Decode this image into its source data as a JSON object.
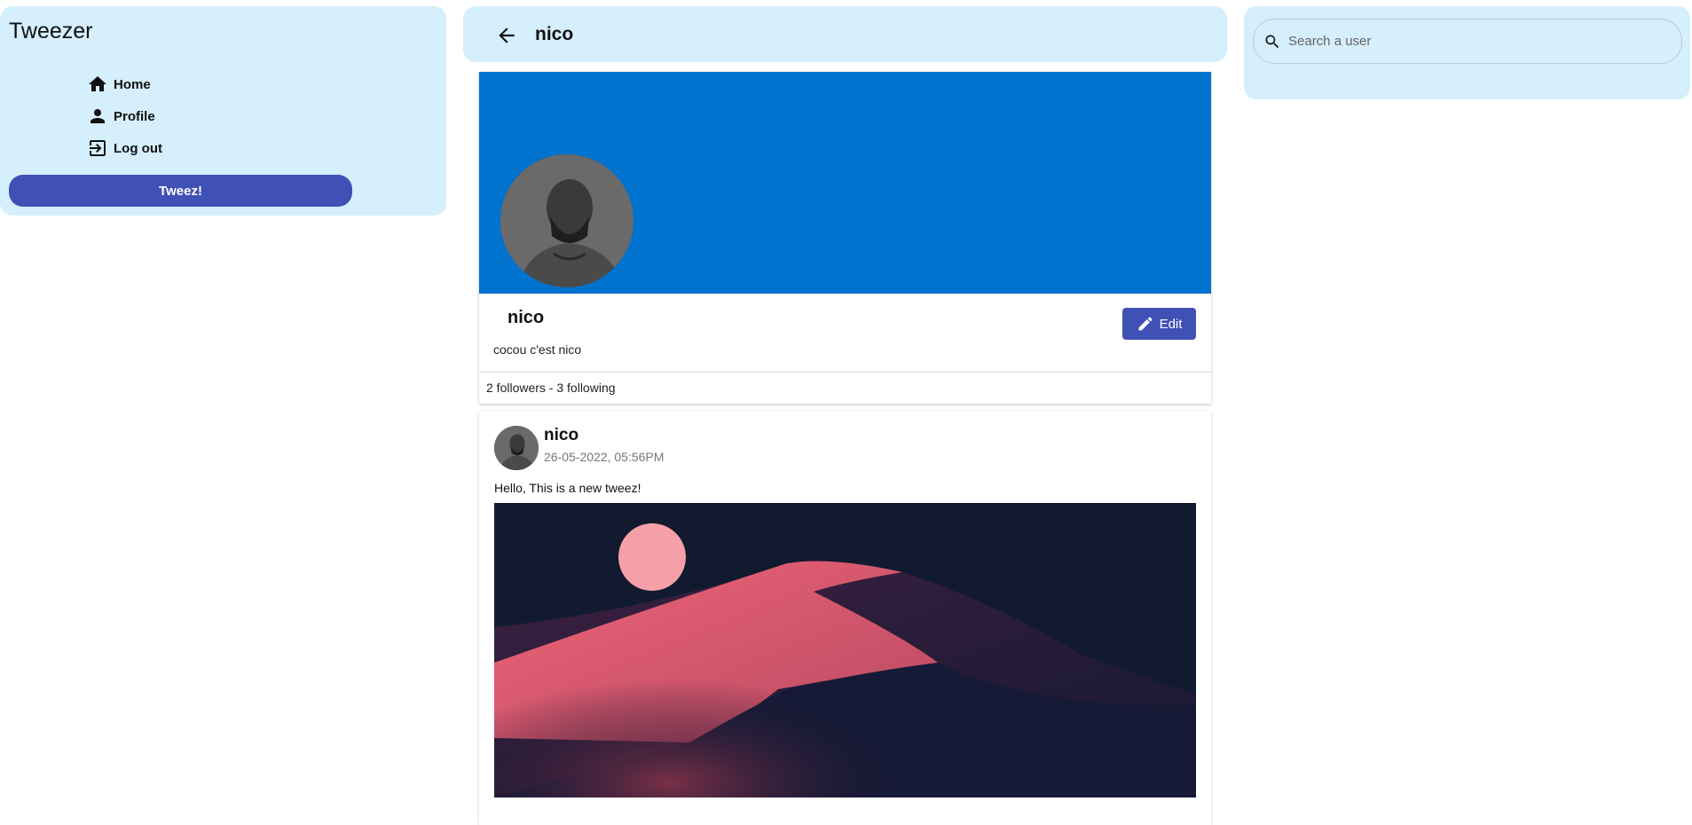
{
  "app": {
    "title": "Tweezer"
  },
  "sidebar": {
    "items": [
      {
        "label": "Home",
        "icon": "home-icon"
      },
      {
        "label": "Profile",
        "icon": "person-icon"
      },
      {
        "label": "Log out",
        "icon": "logout-icon"
      }
    ],
    "tweez_label": "Tweez!"
  },
  "header": {
    "title": "nico",
    "back_icon": "arrow-left-icon"
  },
  "profile": {
    "name": "nico",
    "bio": "cocou c'est nico",
    "edit_label": "Edit",
    "stats": "2 followers - 3 following",
    "banner_color": "#0073cf"
  },
  "post": {
    "author": "nico",
    "date": "26-05-2022, 05:56PM",
    "text": "Hello,  This is a new tweez!"
  },
  "search": {
    "placeholder": "Search a user"
  },
  "colors": {
    "panel": "#d5effc",
    "accent": "#3f51b5"
  }
}
